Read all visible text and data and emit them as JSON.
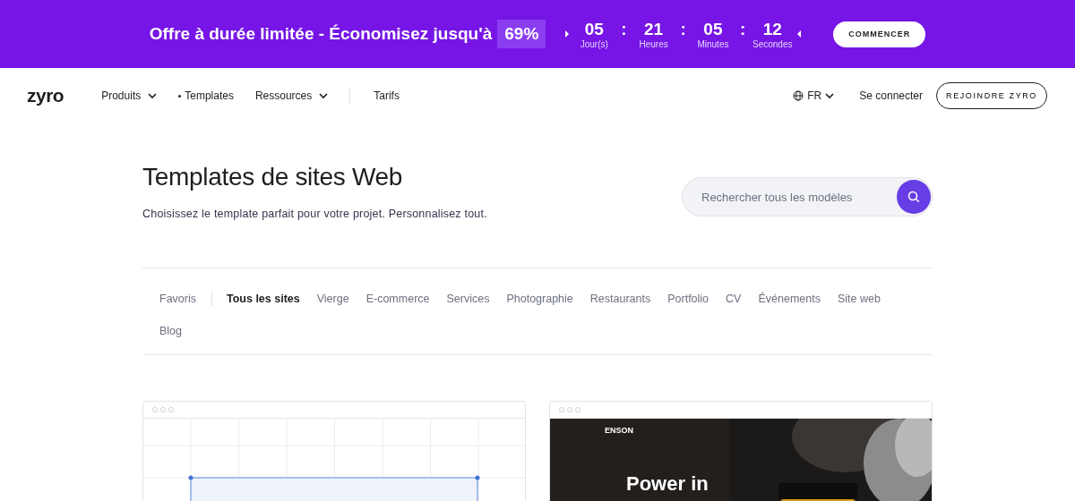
{
  "banner": {
    "offer": "Offre à durée limitée - Économisez jusqu'à",
    "discount": "69%",
    "countdown": [
      {
        "value": "05",
        "unit": "Jour(s)"
      },
      {
        "value": "21",
        "unit": "Heures"
      },
      {
        "value": "05",
        "unit": "Minutes"
      },
      {
        "value": "12",
        "unit": "Secondes"
      }
    ],
    "separator": ":",
    "button": "COMMENCER"
  },
  "nav": {
    "logo": "zyro",
    "items": [
      {
        "label": "Produits",
        "kind": "dropdown"
      },
      {
        "label": "Templates",
        "kind": "current"
      },
      {
        "label": "Ressources",
        "kind": "dropdown"
      },
      {
        "label": "Tarifs",
        "kind": "link"
      }
    ],
    "language": "FR",
    "login": "Se connecter",
    "signup": "REJOINDRE ZYRO"
  },
  "header": {
    "title": "Templates de sites Web",
    "subtitle": "Choisissez le template parfait pour votre projet. Personnalisez tout.",
    "search": {
      "placeholder": "Rechercher tous les modèles"
    }
  },
  "filters": [
    {
      "label": "Favoris",
      "selected": false
    },
    {
      "label": "Tous les sites",
      "selected": true
    },
    {
      "label": "Vierge",
      "selected": false
    },
    {
      "label": "E-commerce",
      "selected": false
    },
    {
      "label": "Services",
      "selected": false
    },
    {
      "label": "Photographie",
      "selected": false
    },
    {
      "label": "Restaurants",
      "selected": false
    },
    {
      "label": "Portfolio",
      "selected": false
    },
    {
      "label": "CV",
      "selected": false
    },
    {
      "label": "Événements",
      "selected": false
    },
    {
      "label": "Site web",
      "selected": false
    },
    {
      "label": "Blog",
      "selected": false
    }
  ],
  "templates": [
    {
      "kind": "blank"
    },
    {
      "kind": "site",
      "brand": "ENSON",
      "headline": "Power in"
    }
  ]
}
